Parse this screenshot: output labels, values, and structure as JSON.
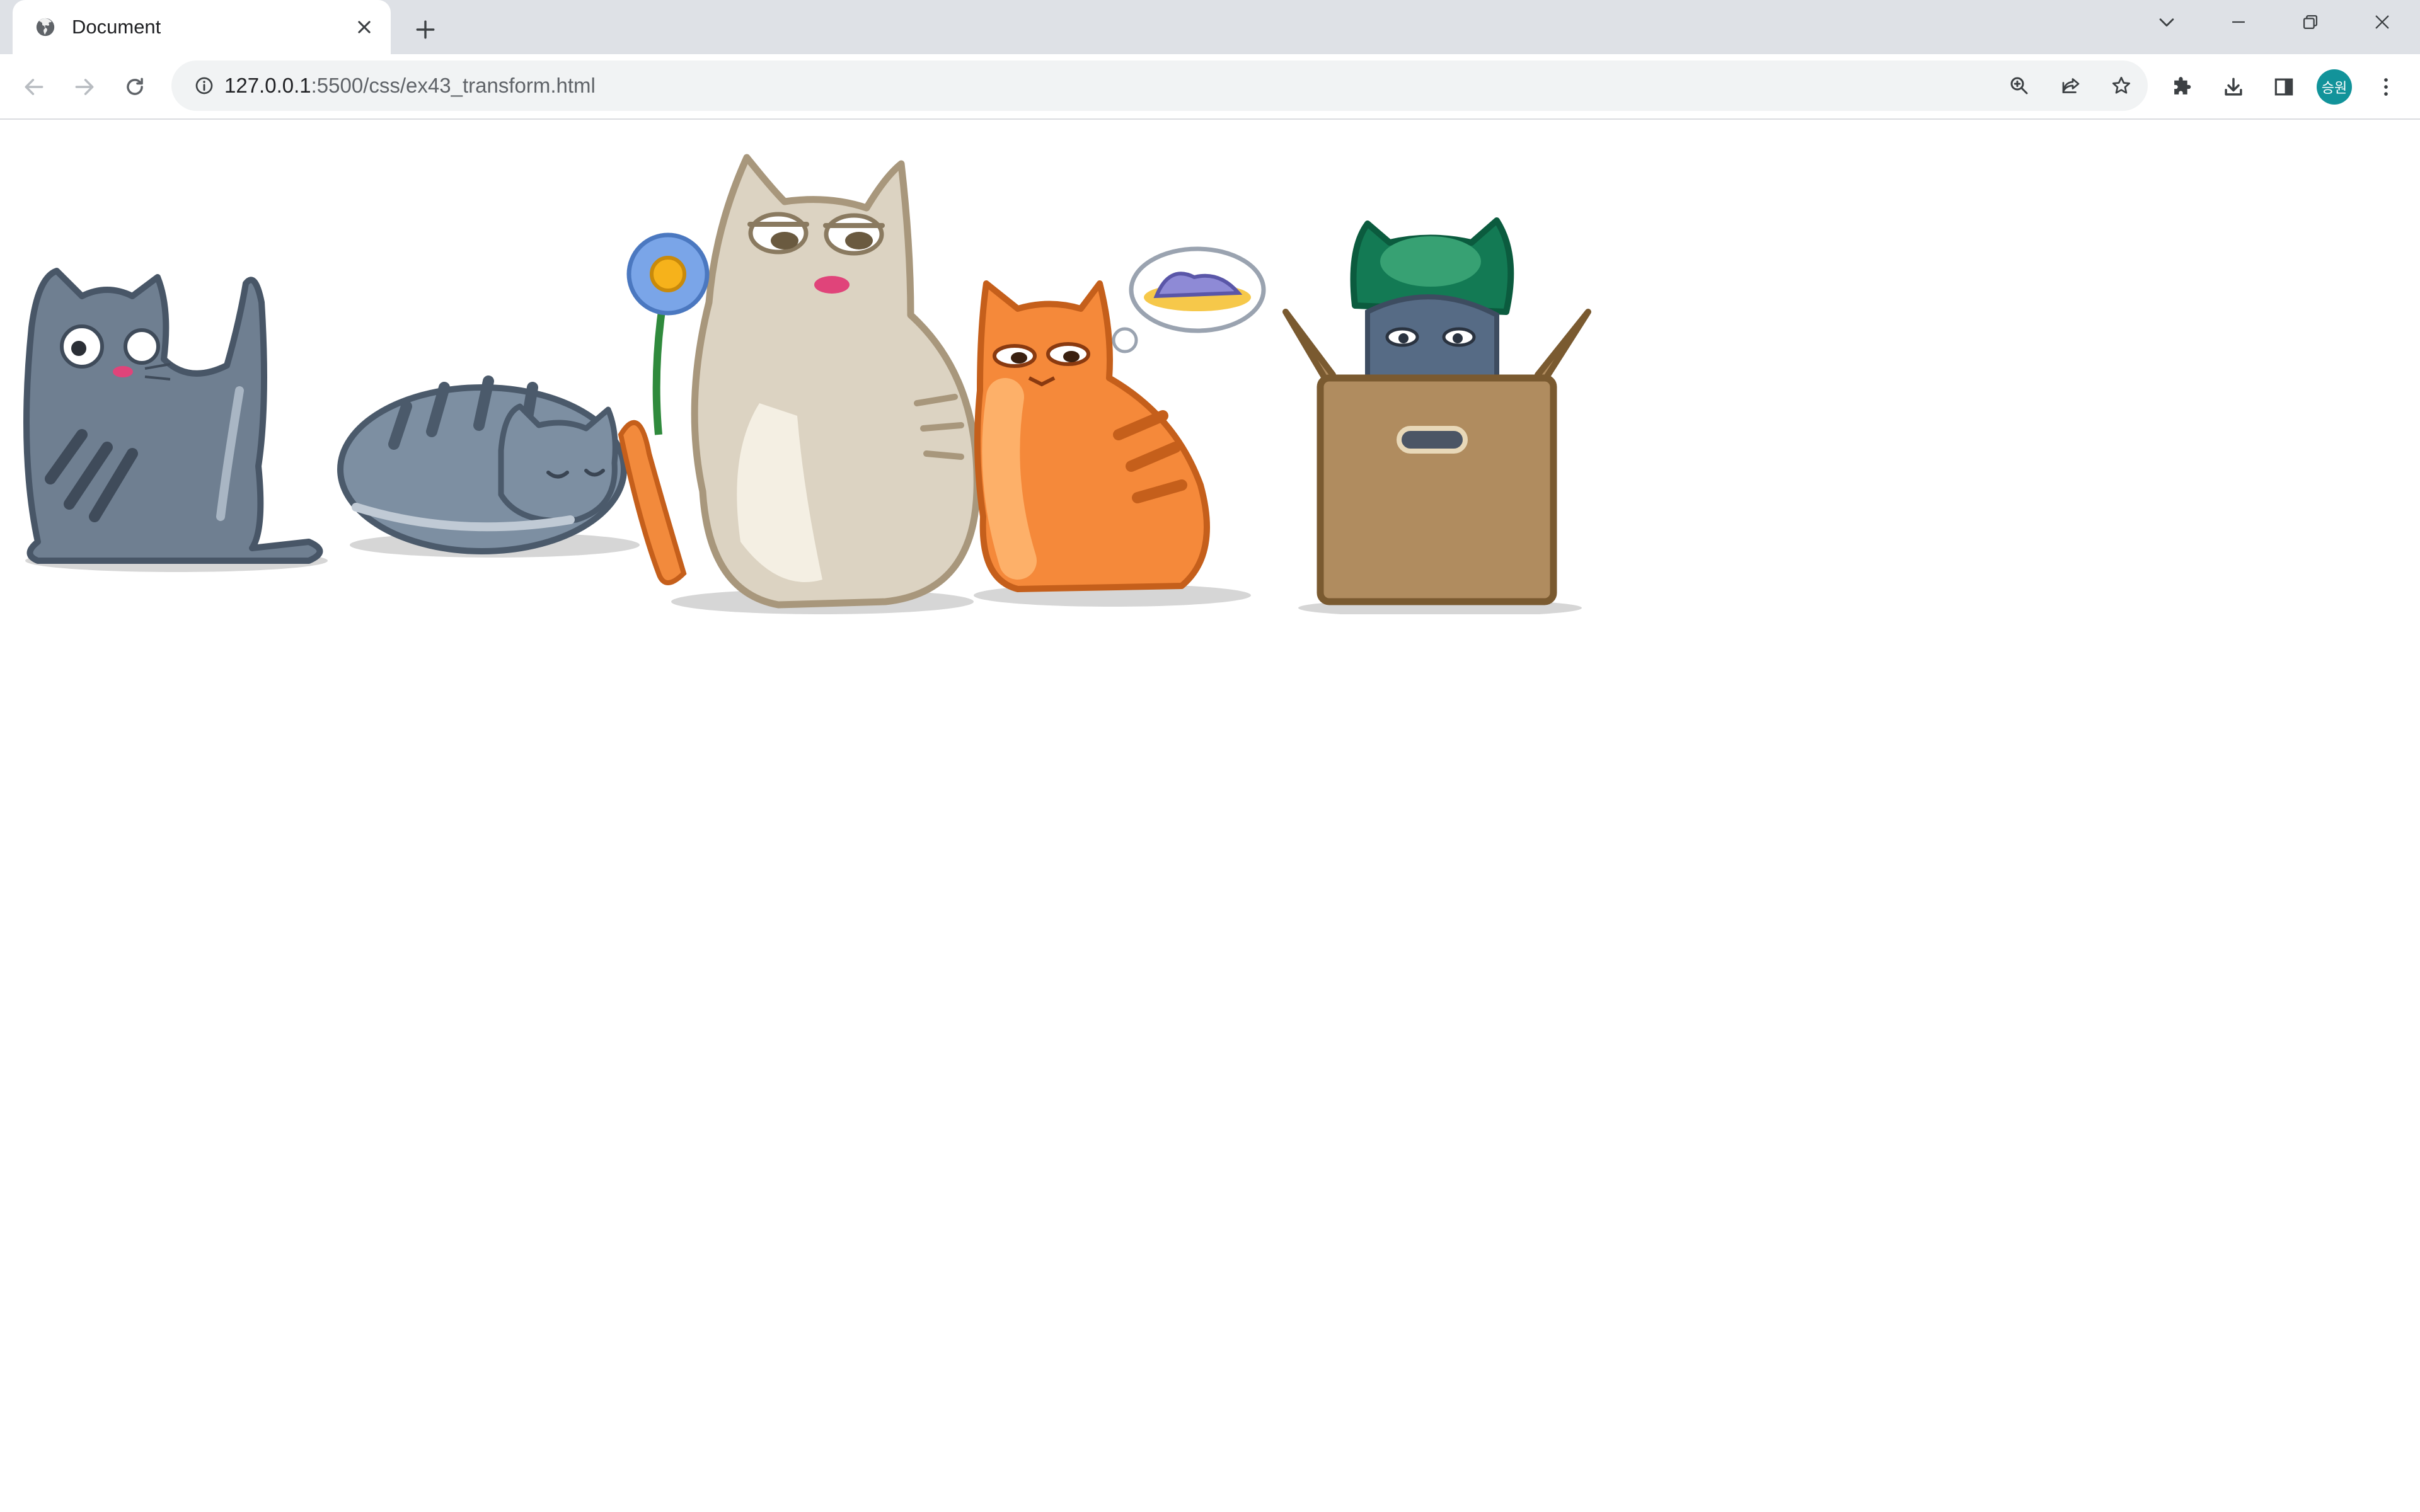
{
  "tab": {
    "title": "Document"
  },
  "toolbar": {
    "url_host": "127.0.0.1",
    "url_rest": ":5500/css/ex43_transform.html"
  },
  "profile": {
    "avatar_text": "승원"
  },
  "colors": {
    "tabstrip_bg": "#dee1e6",
    "omnibox_bg": "#f1f3f4",
    "avatar_bg": "#12939a"
  },
  "icons": {
    "tab_favicon": "globe-icon",
    "close": "close-icon",
    "new_tab": "plus-icon",
    "back": "back-arrow-icon",
    "forward": "forward-arrow-icon",
    "reload": "reload-icon",
    "site_info": "info-icon",
    "zoom": "zoom-icon",
    "share": "share-icon",
    "bookmark": "star-icon",
    "extensions": "puzzle-icon",
    "downloads": "download-icon",
    "side_panel": "side-panel-icon",
    "menu": "kebab-menu-icon"
  }
}
